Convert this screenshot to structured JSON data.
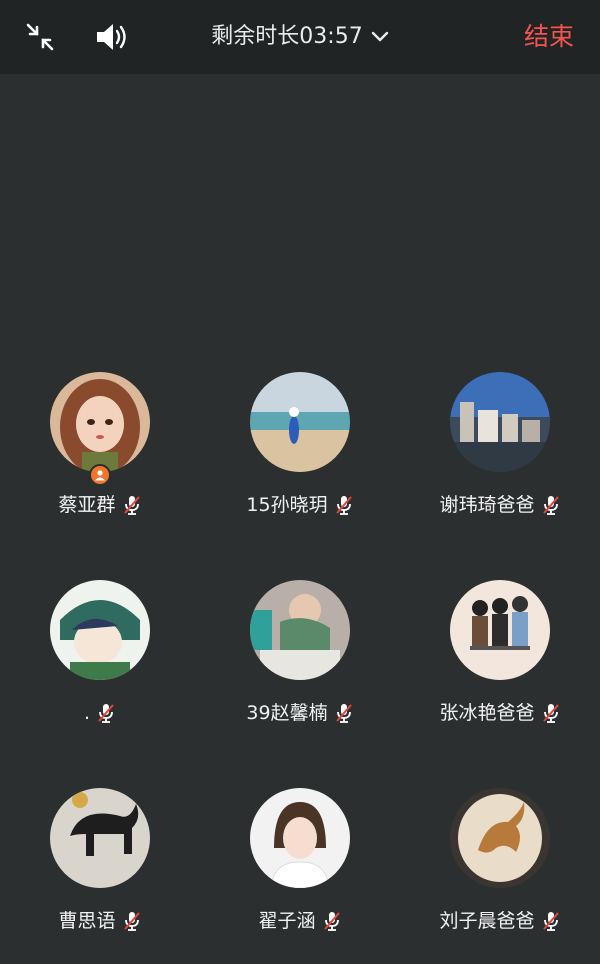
{
  "header": {
    "collapse_icon": "collapse-arrows-icon",
    "speaker_icon": "speaker-icon",
    "timer_text": "剩余时长03:57",
    "dropdown_icon": "chevron-down-icon",
    "end_label": "结束",
    "end_color": "#f2554d"
  },
  "participants": [
    {
      "name": "蔡亚群",
      "host": true,
      "muted": true
    },
    {
      "name": "15孙晓玥",
      "host": false,
      "muted": true
    },
    {
      "name": "谢玮琦爸爸",
      "host": false,
      "muted": true
    },
    {
      "name": ".",
      "host": false,
      "muted": true
    },
    {
      "name": "39赵馨楠",
      "host": false,
      "muted": true
    },
    {
      "name": "张冰艳爸爸",
      "host": false,
      "muted": true
    },
    {
      "name": "曹思语",
      "host": false,
      "muted": true
    },
    {
      "name": "翟子涵",
      "host": false,
      "muted": true
    },
    {
      "name": "刘子晨爸爸",
      "host": false,
      "muted": true
    }
  ],
  "colors": {
    "background": "#2b2f30",
    "topbar": "#212424",
    "host_badge": "#f0762c",
    "mute_slash": "#e8453c"
  }
}
